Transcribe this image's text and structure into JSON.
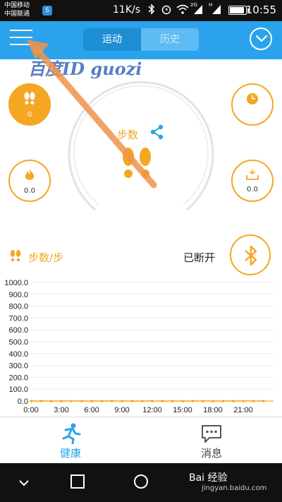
{
  "statusbar": {
    "carrier1": "中国移动",
    "carrier2": "中国联通",
    "app_badge": "S",
    "speed": "11K/s",
    "signal_label_2g": "2G",
    "signal_label_h": "H",
    "time": "10:55",
    "battery_level": 0.95
  },
  "header": {
    "tabs": [
      {
        "label": "运动",
        "active": true
      },
      {
        "label": "历史",
        "active": false
      }
    ],
    "watermark": "百度ID guozi"
  },
  "main": {
    "steps_button_value": "0",
    "calorie_value": "0.0",
    "time_button_value": "",
    "weight_value": "0.0",
    "center_label": "步数"
  },
  "chart_header": {
    "title": "步数/步",
    "status": "已断开"
  },
  "chart_data": {
    "type": "line",
    "x": [
      "0:00",
      "3:00",
      "6:00",
      "9:00",
      "12:00",
      "15:00",
      "18:00",
      "21:00"
    ],
    "y_ticks": [
      "0.0",
      "100.0",
      "200.0",
      "300.0",
      "400.0",
      "500.0",
      "600.0",
      "700.0",
      "800.0",
      "900.0",
      "1000.0"
    ],
    "ylim": [
      0,
      1000
    ],
    "series": [
      {
        "values": [
          0,
          0,
          0,
          0,
          0,
          0,
          0,
          0,
          0,
          0,
          0,
          0,
          0,
          0,
          0,
          0,
          0,
          0,
          0,
          0,
          0,
          0,
          0,
          0
        ]
      }
    ],
    "grid": true
  },
  "bottom_nav": {
    "health_label": "健康",
    "messages_label": "消息"
  },
  "sysnav": {
    "brand": "Bai 经验",
    "site": "jingyan.baidu.com"
  },
  "colors": {
    "accent": "#2aa3ec",
    "orange": "#f5a623"
  }
}
